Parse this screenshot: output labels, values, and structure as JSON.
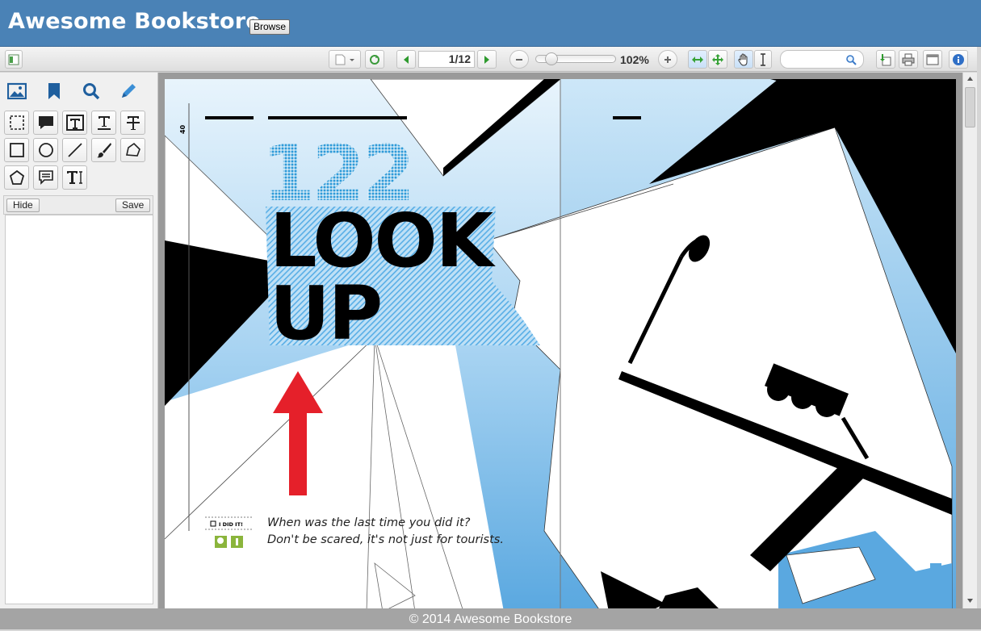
{
  "app": {
    "title": "Awesome Bookstore",
    "browse_label": "Browse"
  },
  "toolbar": {
    "page_value": "1/12",
    "zoom_label": "102%",
    "zoom_level_percent": 102,
    "search_placeholder": ""
  },
  "sidebar": {
    "tabs": [
      "image-icon",
      "bookmark-icon",
      "search-icon",
      "pencil-icon"
    ],
    "hide_label": "Hide",
    "save_label": "Save"
  },
  "document": {
    "page_number": "40",
    "headline_number": "122",
    "headline_line1": "LOOK",
    "headline_line2": "UP",
    "checkbox_label": "I DID IT!",
    "caption_line1": "When was the last time you did it?",
    "caption_line2": "Don't be scared, it's not just for tourists.",
    "colors": {
      "sky": "#7fbde8",
      "accent_red": "#e5202a",
      "number_blue": "#2e9ad8"
    }
  },
  "footer": {
    "copyright": "© 2014 Awesome Bookstore"
  }
}
